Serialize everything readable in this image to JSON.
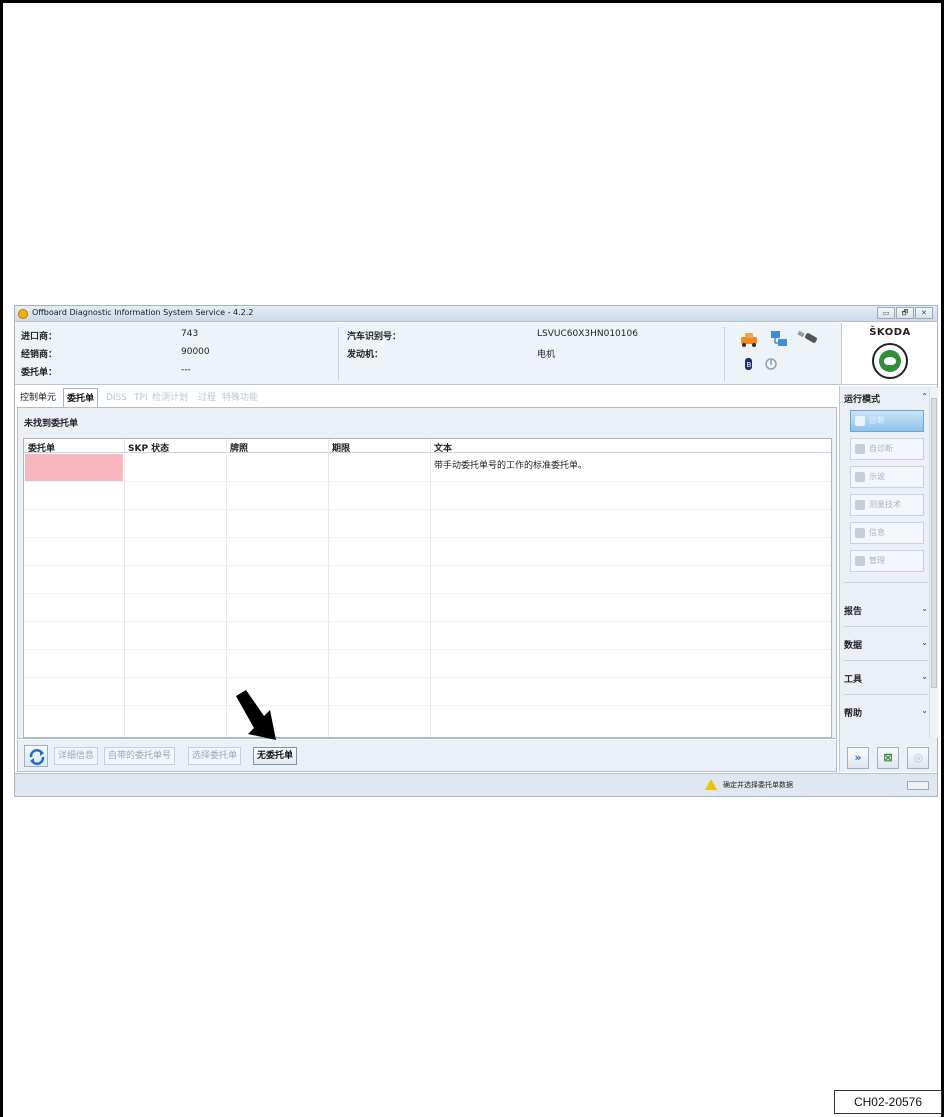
{
  "window": {
    "title": "Offboard Diagnostic Information System Service - 4.2.2",
    "controls": [
      "▭",
      "🗗",
      "✕"
    ]
  },
  "info": {
    "importer_label": "进口商：",
    "importer_value": "743",
    "dealer_label": "经销商：",
    "dealer_value": "90000",
    "order_label": "委托单：",
    "order_value": "---",
    "vin_label": "汽车识别号：",
    "vin_value": "LSVUC60X3HN010106",
    "engine_label": "发动机：",
    "engine_value": "电机"
  },
  "brand": {
    "name": "ŠKODA",
    "logo_color": "#2f8f3a"
  },
  "tabs": {
    "control_units": "控制单元",
    "orders": "委托单",
    "diss": "DISS",
    "tpi": "TPI",
    "test_plan": "检测计划",
    "process": "过程",
    "special_functions": "特殊功能"
  },
  "panel": {
    "not_found": "未找到委托单",
    "columns": [
      "委托单",
      "SKP 状态",
      "牌照",
      "期限",
      "文本"
    ],
    "row_text": "带手动委托单号的工作的标准委托单。"
  },
  "buttons": {
    "details": "详细信息",
    "own_order_no": "自带的委托单号",
    "select_order": "选择委托单",
    "no_order": "无委托单"
  },
  "side": {
    "run_mode": "运行模式",
    "diagnosis": "诊断",
    "self_diagnosis": "自诊断",
    "oscilloscope": "示波",
    "measurement": "测量技术",
    "info": "信息",
    "admin": "管理",
    "report": "报告",
    "data": "数据",
    "tools": "工具",
    "help": "帮助"
  },
  "status": {
    "message": "确定并选择委托单数据"
  },
  "figure_id": "CH02-20576",
  "colors": {
    "accent_blue": "#8fc3ea",
    "pink_cell": "#f7b9bf",
    "warning": "#f2c200"
  }
}
